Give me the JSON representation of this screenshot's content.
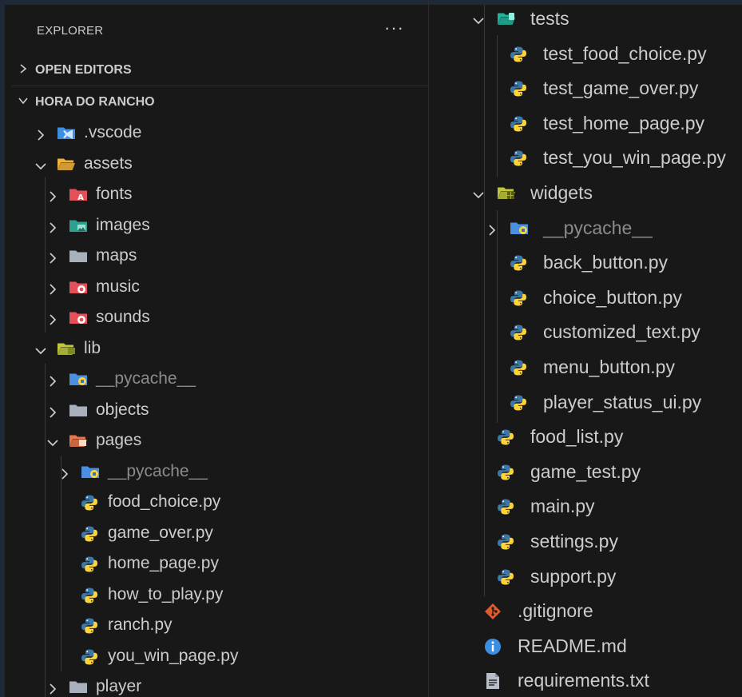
{
  "explorer": {
    "title": "EXPLORER",
    "more": "···"
  },
  "sections": {
    "open_editors": "OPEN EDITORS",
    "project": "HORA DO RANCHO"
  },
  "left_tree": [
    {
      "label": ".vscode",
      "icon": "vscode-folder-icon",
      "chevron": "right",
      "level": 1
    },
    {
      "label": "assets",
      "icon": "assets-folder-open-icon",
      "chevron": "down",
      "level": 1
    },
    {
      "label": "fonts",
      "icon": "fonts-folder-icon",
      "chevron": "right",
      "level": 2
    },
    {
      "label": "images",
      "icon": "images-folder-icon",
      "chevron": "right",
      "level": 2
    },
    {
      "label": "maps",
      "icon": "folder-icon",
      "chevron": "right",
      "level": 2
    },
    {
      "label": "music",
      "icon": "music-folder-icon",
      "chevron": "right",
      "level": 2
    },
    {
      "label": "sounds",
      "icon": "sounds-folder-icon",
      "chevron": "right",
      "level": 2
    },
    {
      "label": "lib",
      "icon": "lib-folder-open-icon",
      "chevron": "down",
      "level": 1
    },
    {
      "label": "__pycache__",
      "icon": "pycache-folder-icon",
      "chevron": "right",
      "level": 2,
      "dim": true
    },
    {
      "label": "objects",
      "icon": "folder-icon",
      "chevron": "right",
      "level": 2
    },
    {
      "label": "pages",
      "icon": "pages-folder-open-icon",
      "chevron": "down",
      "level": 2
    },
    {
      "label": "__pycache__",
      "icon": "pycache-folder-icon",
      "chevron": "right",
      "level": 3,
      "dim": true
    },
    {
      "label": "food_choice.py",
      "icon": "python-file-icon",
      "level": 3
    },
    {
      "label": "game_over.py",
      "icon": "python-file-icon",
      "level": 3
    },
    {
      "label": "home_page.py",
      "icon": "python-file-icon",
      "level": 3
    },
    {
      "label": "how_to_play.py",
      "icon": "python-file-icon",
      "level": 3
    },
    {
      "label": "ranch.py",
      "icon": "python-file-icon",
      "level": 3
    },
    {
      "label": "you_win_page.py",
      "icon": "python-file-icon",
      "level": 3
    },
    {
      "label": "player",
      "icon": "folder-icon",
      "chevron": "right",
      "level": 2
    }
  ],
  "right_tree": [
    {
      "label": "tests",
      "icon": "tests-folder-open-icon",
      "chevron": "down",
      "level": 1
    },
    {
      "label": "test_food_choice.py",
      "icon": "python-file-icon",
      "level": 2
    },
    {
      "label": "test_game_over.py",
      "icon": "python-file-icon",
      "level": 2
    },
    {
      "label": "test_home_page.py",
      "icon": "python-file-icon",
      "level": 2
    },
    {
      "label": "test_you_win_page.py",
      "icon": "python-file-icon",
      "level": 2
    },
    {
      "label": "widgets",
      "icon": "widgets-folder-open-icon",
      "chevron": "down",
      "level": 1
    },
    {
      "label": "__pycache__",
      "icon": "pycache-folder-icon",
      "chevron": "right",
      "level": 2,
      "dim": true
    },
    {
      "label": "back_button.py",
      "icon": "python-file-icon",
      "level": 2
    },
    {
      "label": "choice_button.py",
      "icon": "python-file-icon",
      "level": 2
    },
    {
      "label": "customized_text.py",
      "icon": "python-file-icon",
      "level": 2
    },
    {
      "label": "menu_button.py",
      "icon": "python-file-icon",
      "level": 2
    },
    {
      "label": "player_status_ui.py",
      "icon": "python-file-icon",
      "level": 2
    },
    {
      "label": "food_list.py",
      "icon": "python-file-icon",
      "level": 1
    },
    {
      "label": "game_test.py",
      "icon": "python-file-icon",
      "level": 1
    },
    {
      "label": "main.py",
      "icon": "python-file-icon",
      "level": 1
    },
    {
      "label": "settings.py",
      "icon": "python-file-icon",
      "level": 1
    },
    {
      "label": "support.py",
      "icon": "python-file-icon",
      "level": 1
    },
    {
      "label": ".gitignore",
      "icon": "git-icon",
      "level": 0
    },
    {
      "label": "README.md",
      "icon": "info-icon",
      "level": 0
    },
    {
      "label": "requirements.txt",
      "icon": "text-file-icon",
      "level": 0
    }
  ],
  "colors": {
    "background": "#181818",
    "text": "#cccccc",
    "dim_text": "#8b8b8b",
    "python_blue": "#3b77a8",
    "python_yellow": "#ffd43b"
  }
}
